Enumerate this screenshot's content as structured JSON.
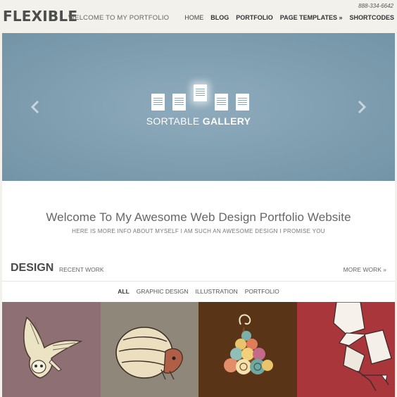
{
  "header": {
    "logo": "FLEXIBLE",
    "tagline": "WELCOME TO MY PORTFOLIO",
    "phone": "888-334-6642",
    "nav": [
      {
        "label": "HOME"
      },
      {
        "label": "BLOG"
      },
      {
        "label": "PORTFOLIO"
      },
      {
        "label": "PAGE TEMPLATES »"
      },
      {
        "label": "SHORTCODES"
      }
    ]
  },
  "slider": {
    "caption_light": "SORTABLE",
    "caption_bold": "GALLERY",
    "prev_icon": "chevron-left-icon",
    "next_icon": "chevron-right-icon",
    "background": "#7f9fb1"
  },
  "welcome": {
    "title": "Welcome To My Awesome Web Design Portfolio Website",
    "subtitle": "HERE IS MORE INFO ABOUT MYSELF I AM SUCH AN AWESOME DESIGN I PROMISE YOU"
  },
  "section": {
    "title": "DESIGN",
    "subtitle": "RECENT WORK",
    "more": "MORE WORK »"
  },
  "filters": [
    "ALL",
    "GRAPHIC DESIGN",
    "ILLUSTRATION",
    "PORTFOLIO"
  ],
  "portfolio": [
    {
      "bg": "#8e6f74",
      "icon": "owl-illustration"
    },
    {
      "bg": "#8f8779",
      "icon": "armadillo-illustration"
    },
    {
      "bg": "#5a3417",
      "icon": "swirl-tree-illustration"
    },
    {
      "bg": "#a8363a",
      "icon": "sketch-figure-illustration"
    }
  ]
}
